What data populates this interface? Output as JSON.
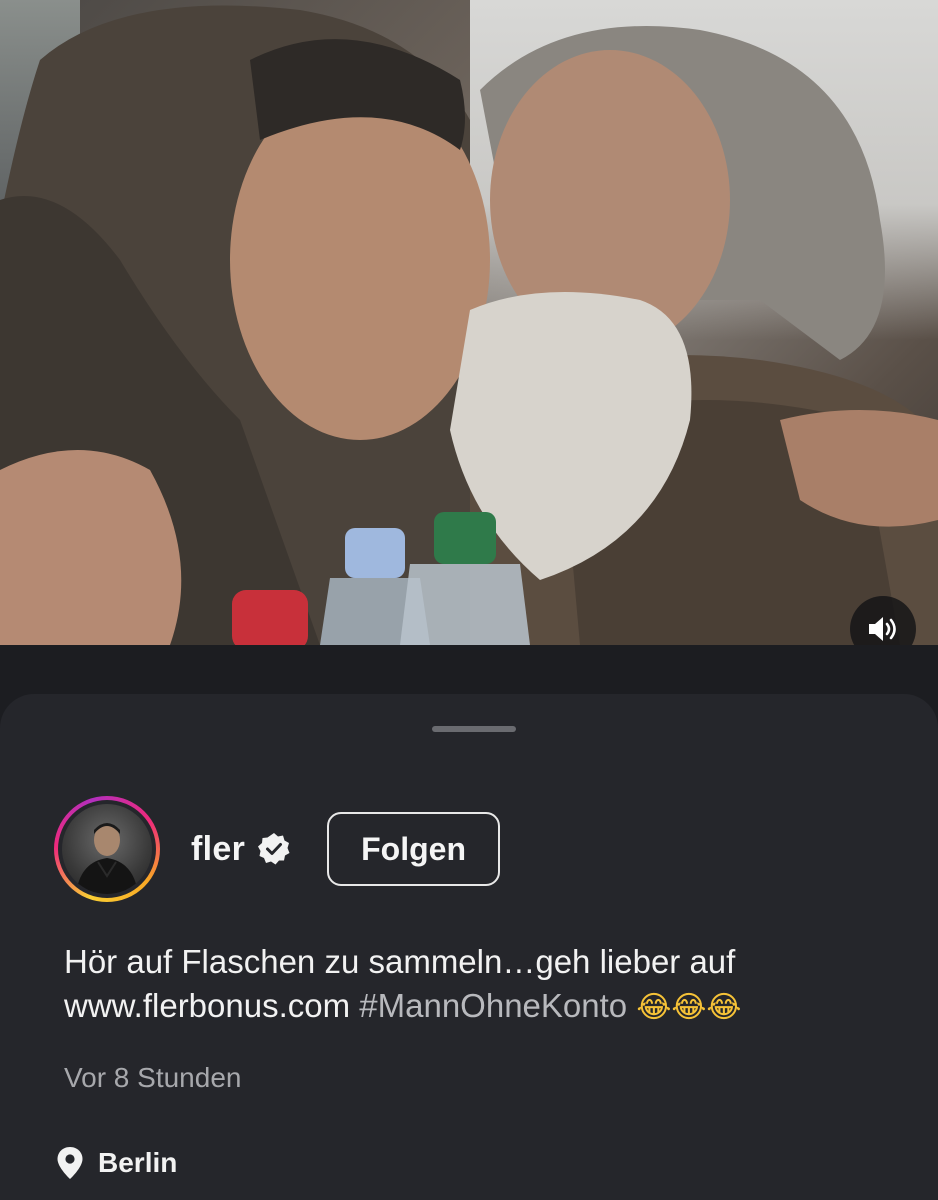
{
  "media": {
    "description_icon": "photo",
    "sound_icon": "speaker-volume-icon"
  },
  "post": {
    "username": "fler",
    "verified": true,
    "follow_label": "Folgen",
    "caption_text": "Hör auf Flaschen zu sammeln…geh lieber auf",
    "caption_link": "www.flerbonus.com",
    "caption_hashtag": "#MannOhneKonto",
    "caption_emojis": "😂😂😂",
    "timestamp": "Vor 8 Stunden",
    "location": "Berlin"
  },
  "colors": {
    "sheet_background": "#25262b",
    "page_background": "#1c1d21",
    "text_primary": "#f2f2f2",
    "text_secondary": "#a7a8ac",
    "hashtag": "#b8b9bd"
  }
}
